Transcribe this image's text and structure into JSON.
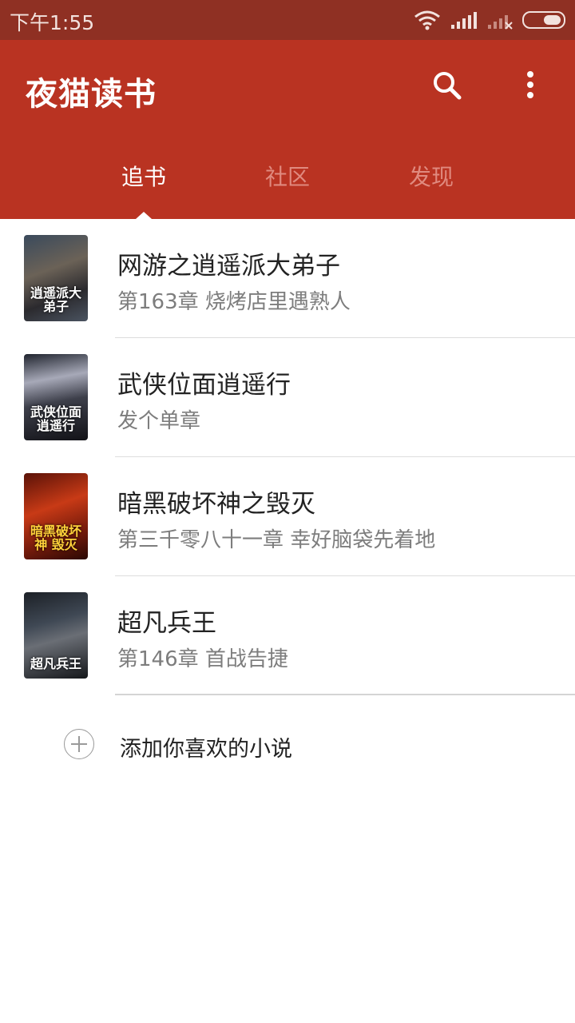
{
  "status_bar": {
    "time": "下午1:55",
    "icons": [
      "wifi-icon",
      "signal-icon",
      "signal-no-service-icon",
      "battery-icon"
    ]
  },
  "app_bar": {
    "title": "夜猫读书",
    "search_icon": "search-icon",
    "more_icon": "more-vert-icon"
  },
  "tabs": [
    {
      "label": "追书",
      "active": true
    },
    {
      "label": "社区",
      "active": false
    },
    {
      "label": "发现",
      "active": false
    }
  ],
  "books": [
    {
      "title": "网游之逍遥派大弟子",
      "chapter": "第163章 烧烤店里遇熟人",
      "cover_text": "逍遥派大弟子"
    },
    {
      "title": "武侠位面逍遥行",
      "chapter": "发个单章",
      "cover_text": "武侠位面逍遥行"
    },
    {
      "title": "暗黑破坏神之毁灭",
      "chapter": "第三千零八十一章 幸好脑袋先着地",
      "cover_text": "暗黑破坏神 毁灭"
    },
    {
      "title": "超凡兵王",
      "chapter": "第146章 首战告捷",
      "cover_text": "超凡兵王"
    }
  ],
  "add_novel": {
    "label": "添加你喜欢的小说",
    "icon": "add-circle-icon"
  },
  "colors": {
    "status_bar": "#8f3023",
    "app_bar": "#b93322",
    "tab_active": "#ffffff",
    "tab_inactive": "#e08a7f"
  }
}
